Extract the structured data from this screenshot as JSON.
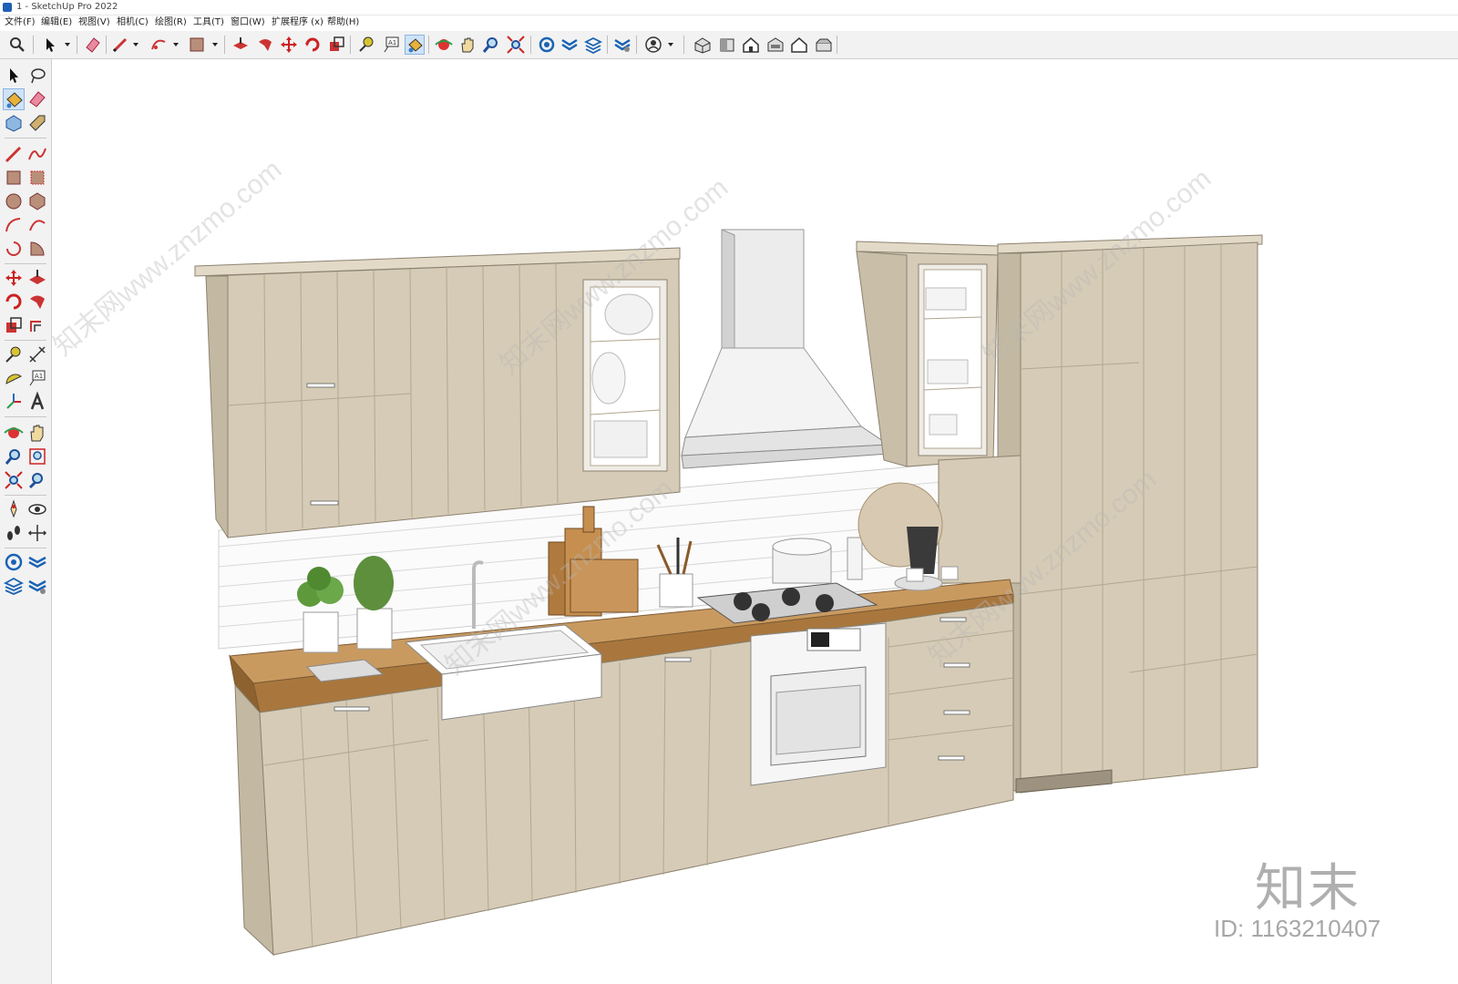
{
  "window": {
    "title": "1 - SketchUp Pro 2022"
  },
  "menu": [
    {
      "label": "文件(F)"
    },
    {
      "label": "编辑(E)"
    },
    {
      "label": "视图(V)"
    },
    {
      "label": "相机(C)"
    },
    {
      "label": "绘图(R)"
    },
    {
      "label": "工具(T)"
    },
    {
      "label": "窗口(W)"
    },
    {
      "label": "扩展程序 (x)"
    },
    {
      "label": "帮助(H)"
    }
  ],
  "toolbar": {
    "icons": [
      "search-icon",
      "select-arrow-icon",
      "eraser-icon",
      "pencil-line-icon",
      "arc-icon",
      "rectangle-icon",
      "push-pull-icon",
      "follow-me-icon",
      "move-icon",
      "rotate-icon",
      "scale-icon",
      "tape-measure-icon",
      "text-label-icon",
      "paint-bucket-icon",
      "orbit-icon",
      "pan-hand-icon",
      "zoom-icon",
      "zoom-extents-icon",
      "warehouse-icon",
      "extension-warehouse-icon",
      "layout-icon",
      "extension-manager-icon",
      "account-icon",
      "iso-view-icon",
      "top-view-icon",
      "front-view-icon",
      "right-view-icon",
      "back-view-icon",
      "left-view-icon"
    ],
    "active_tool": "paint-bucket-icon"
  },
  "left_toolbar": {
    "icons": [
      "select-icon",
      "lasso-icon",
      "paint-bucket-icon",
      "eraser-icon",
      "component-icon",
      "tag-icon",
      "pencil-icon",
      "freehand-icon",
      "rectangle-icon",
      "rotated-rectangle-icon",
      "circle-icon",
      "polygon-icon",
      "arc-icon",
      "two-point-arc-icon",
      "three-point-arc-icon",
      "pie-icon",
      "move-icon",
      "push-pull-icon",
      "rotate-icon",
      "follow-me-icon",
      "scale-icon",
      "offset-icon",
      "tape-measure-icon",
      "dimension-icon",
      "protractor-icon",
      "text-icon",
      "axes-icon",
      "3d-text-icon",
      "orbit-icon",
      "pan-icon",
      "zoom-icon",
      "zoom-window-icon",
      "zoom-extents-icon",
      "previous-view-icon",
      "position-camera-icon",
      "look-around-icon",
      "walk-icon",
      "section-plane-icon",
      "warehouse-icon",
      "extension-warehouse-icon",
      "layout-icon",
      "extension-manager-icon"
    ]
  },
  "colors": {
    "cabinet": "#d6cbb6",
    "cabinet_dark": "#bfb39b",
    "countertop": "#b4824a",
    "tile": "#f7f7f7",
    "hood": "#e6e6e6",
    "toolbar_bg": "#f2f2f2",
    "accent": "#cfe3f7"
  },
  "watermark": {
    "logo_text": "知末",
    "id_text": "ID: 1163210407",
    "site_text": "知末网www.znzmo.com"
  }
}
